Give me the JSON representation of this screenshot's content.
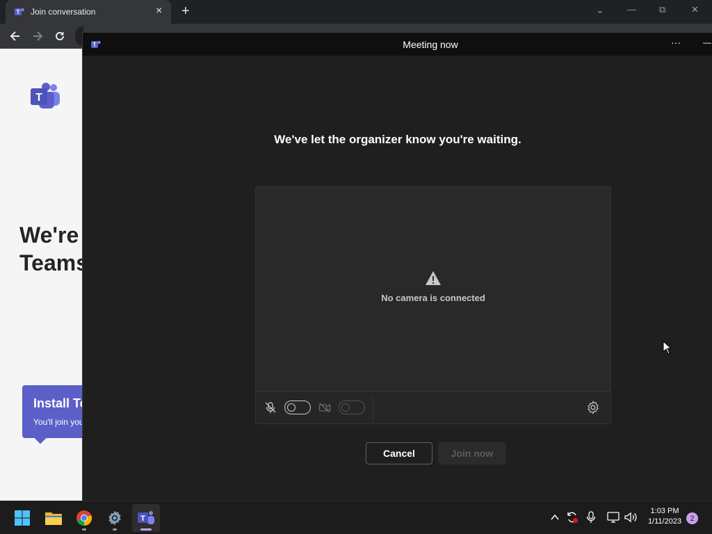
{
  "browser": {
    "tab_title": "Join conversation",
    "tab_close": "×",
    "new_tab": "+",
    "window_controls": [
      "⌄",
      "—",
      "⧉",
      "✕"
    ]
  },
  "page": {
    "heading_line1": "We're",
    "heading_line2": "Teams",
    "install_title": "Install Te",
    "install_sub": "You'll join you"
  },
  "teams": {
    "window_title": "Meeting now",
    "more_label": "···",
    "minimize_label": "—",
    "waiting_message": "We've let the organizer know you're waiting.",
    "camera_status": "No camera is connected",
    "cancel_label": "Cancel",
    "join_label": "Join now"
  },
  "taskbar": {
    "time": "1:03 PM",
    "date": "1/11/2023",
    "notification_count": "2"
  },
  "colors": {
    "teams_purple": "#5b5fc7",
    "window_bg": "#1f1f1f",
    "titlebar_bg": "#0f0f0f"
  }
}
